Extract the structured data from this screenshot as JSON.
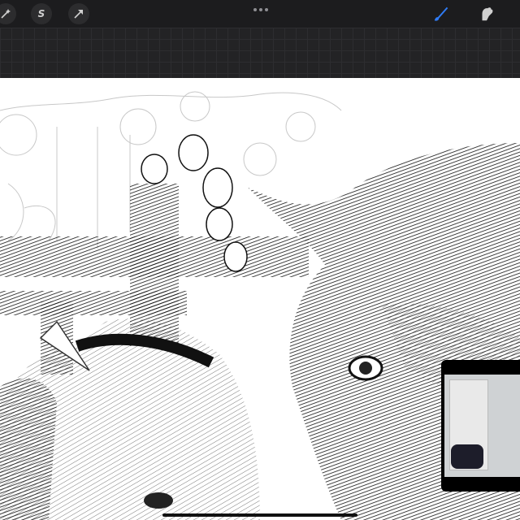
{
  "toolbar": {
    "left_tools": [
      {
        "icon": "magic-wand-icon"
      },
      {
        "icon": "selection-s-icon",
        "glyph": "S"
      },
      {
        "icon": "transform-arrow-icon"
      }
    ],
    "more_icon": "ellipsis-icon",
    "right_tools": [
      {
        "icon": "brush-icon",
        "color": "#2f7bf5"
      },
      {
        "icon": "smudge-icon",
        "color": "#d0d0d0"
      }
    ]
  },
  "canvas": {
    "artwork": "pencil-sketch",
    "background": "#ffffff"
  },
  "pip": {
    "visible": true
  },
  "colors": {
    "toolbar_bg": "#1c1c1e",
    "accent": "#2f7bf5",
    "grid_bg": "#232325"
  }
}
